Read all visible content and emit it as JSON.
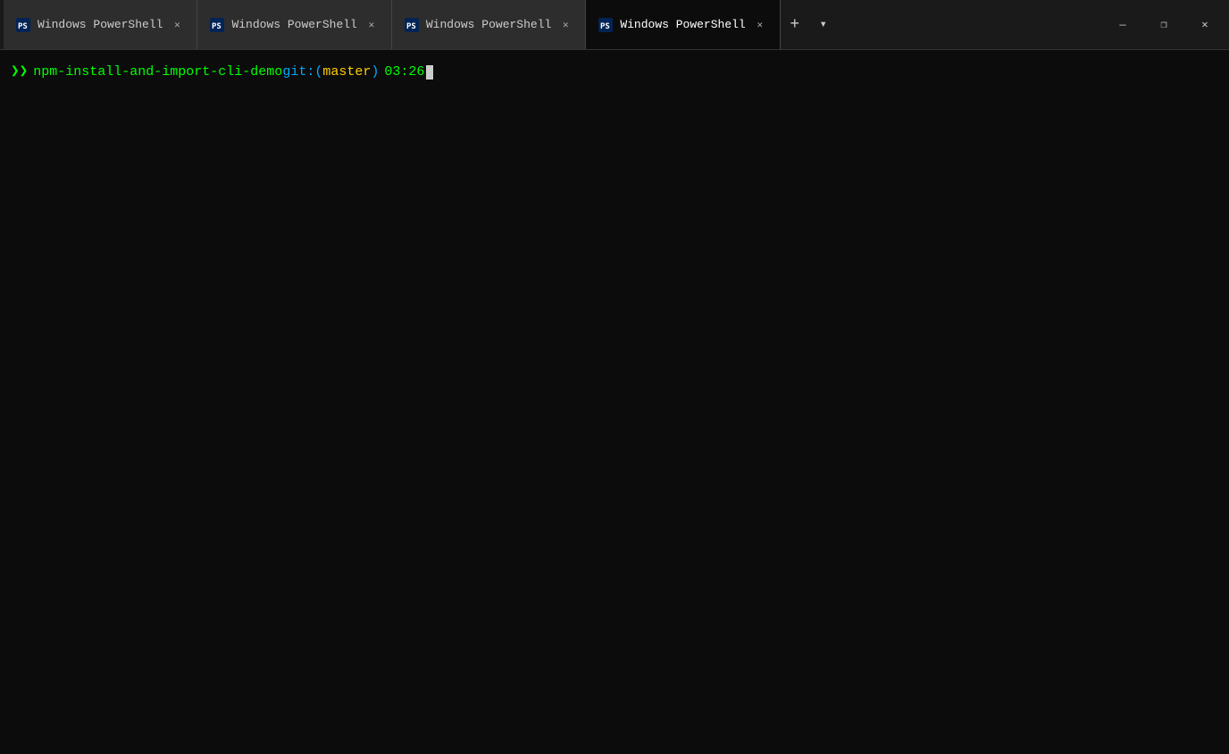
{
  "titleBar": {
    "tabs": [
      {
        "id": "tab1",
        "label": "Windows PowerShell",
        "active": false
      },
      {
        "id": "tab2",
        "label": "Windows PowerShell",
        "active": false
      },
      {
        "id": "tab3",
        "label": "Windows PowerShell",
        "active": false
      },
      {
        "id": "tab4",
        "label": "Windows PowerShell",
        "active": true
      }
    ],
    "addTabLabel": "+",
    "dropdownLabel": "▾",
    "windowControls": {
      "minimize": "—",
      "maximize": "❐",
      "close": "✕"
    }
  },
  "terminal": {
    "promptArrow": "❯❯",
    "promptPath": "npm-install-and-import-cli-demo",
    "promptGitPrefix": " git:",
    "promptGitBranchOpen": "(",
    "promptGitBranch": "master",
    "promptGitBranchClose": ")",
    "promptTime": " 03:26"
  },
  "colors": {
    "tabBarBg": "#1a1a1a",
    "tabActiveBg": "#0c0c0c",
    "tabInactiveBg": "#2d2d2d",
    "terminalBg": "#0c0c0c",
    "promptGreen": "#00ff00",
    "promptBlue": "#00aaff",
    "promptYellow": "#ffcc00",
    "accent": "#0078d4"
  }
}
